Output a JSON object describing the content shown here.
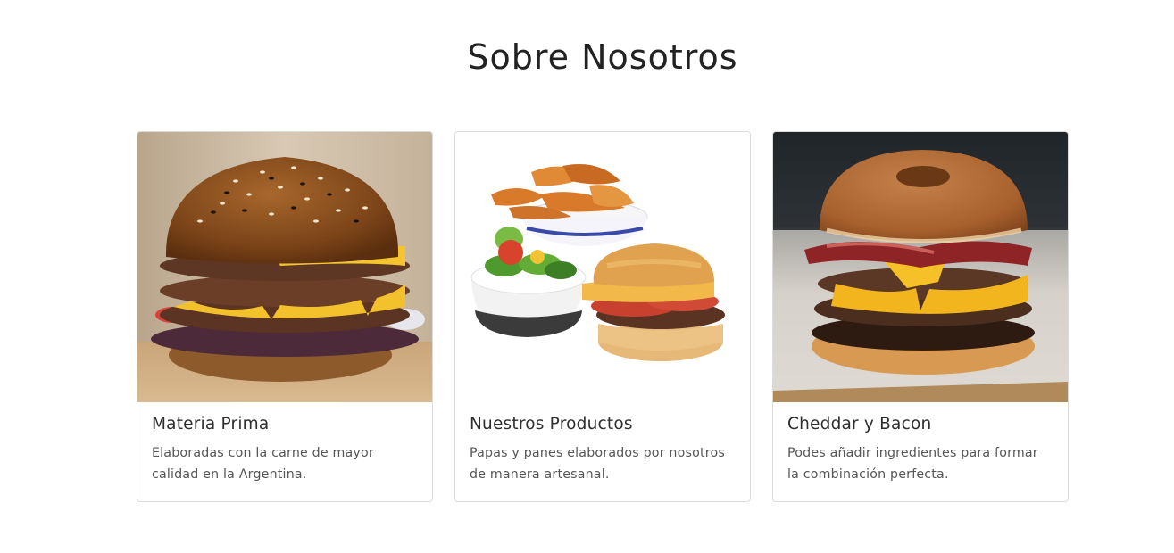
{
  "section": {
    "title": "Sobre Nosotros"
  },
  "cards": [
    {
      "image_alt": "burger-stack-photo",
      "title": "Materia Prima",
      "text": "Elaboradas con la carne de mayor calidad en la Argentina."
    },
    {
      "image_alt": "fries-salad-burger-photo",
      "title": "Nuestros Productos",
      "text": "Papas y panes elaborados por nosotros de manera artesanal."
    },
    {
      "image_alt": "donut-bacon-burger-photo",
      "title": "Cheddar y Bacon",
      "text": "Podes añadir ingredientes para formar la combinación perfecta."
    }
  ],
  "colors": {
    "border": "#dcdcdc",
    "title": "#222222",
    "text": "#555555"
  }
}
